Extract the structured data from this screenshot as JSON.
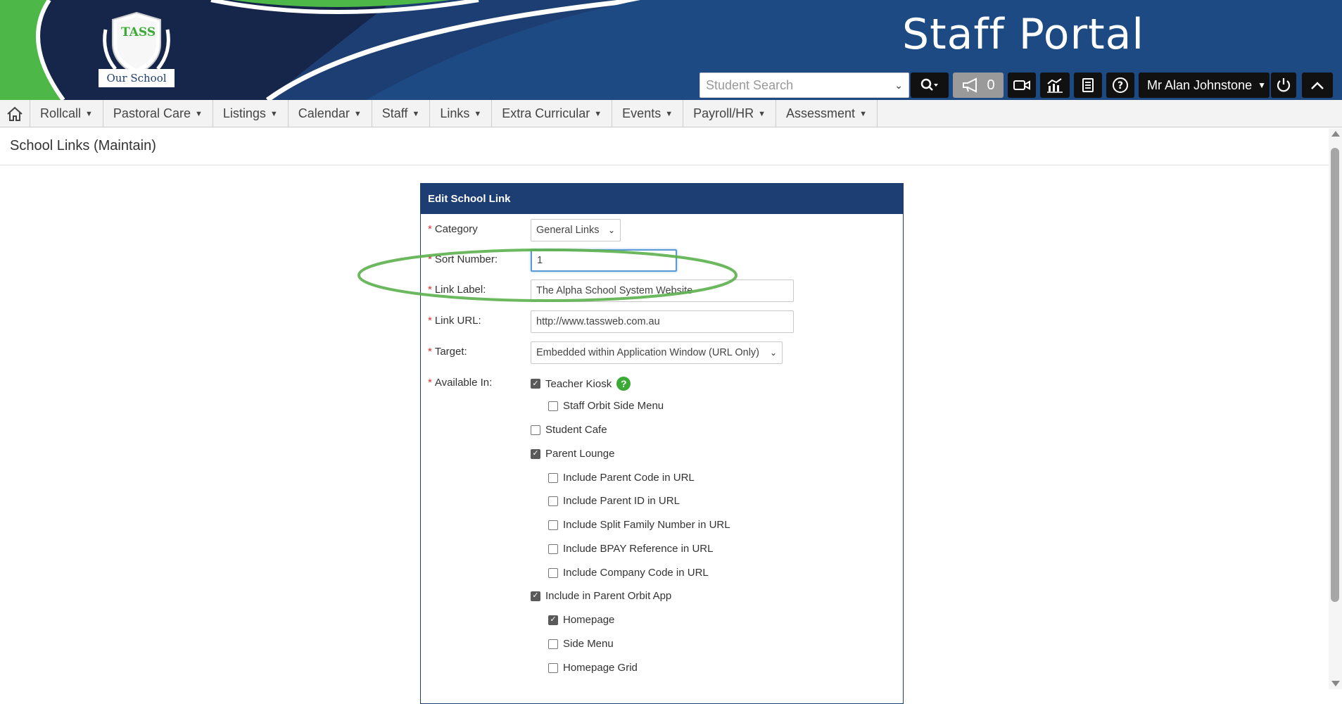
{
  "header": {
    "logo_text": "TASS",
    "logo_caption": "Our School",
    "portal_title": "Staff Portal",
    "search_placeholder": "Student Search",
    "notification_count": "0",
    "user_name": "Mr Alan Johnstone",
    "colors": {
      "banner": "#1d3e72",
      "accent_green": "#4db848"
    }
  },
  "nav": {
    "items": [
      "Rollcall",
      "Pastoral Care",
      "Listings",
      "Calendar",
      "Staff",
      "Links",
      "Extra Curricular",
      "Events",
      "Payroll/HR",
      "Assessment"
    ]
  },
  "page": {
    "title": "School Links (Maintain)"
  },
  "form": {
    "heading": "Edit School Link",
    "required_mark": "*",
    "category": {
      "label": "Category",
      "value": "General Links"
    },
    "sort_number": {
      "label": "Sort Number:",
      "value": "1"
    },
    "link_label": {
      "label": "Link Label:",
      "value": "The Alpha School System Website"
    },
    "link_url": {
      "label": "Link URL:",
      "value": "http://www.tassweb.com.au"
    },
    "target": {
      "label": "Target:",
      "value": "Embedded within Application Window (URL Only)"
    },
    "available_in": {
      "label": "Available In:",
      "options": [
        {
          "label": "Teacher Kiosk",
          "checked": true
        },
        {
          "label": "Staff Orbit Side Menu",
          "checked": false
        },
        {
          "label": "Student Cafe",
          "checked": false
        },
        {
          "label": "Parent Lounge",
          "checked": true
        },
        {
          "label": "Include Parent Code in URL",
          "checked": false
        },
        {
          "label": "Include Parent ID in URL",
          "checked": false
        },
        {
          "label": "Include Split Family Number in URL",
          "checked": false
        },
        {
          "label": "Include BPAY Reference in URL",
          "checked": false
        },
        {
          "label": "Include Company Code in URL",
          "checked": false
        },
        {
          "label": "Include in Parent Orbit App",
          "checked": true
        },
        {
          "label": "Homepage",
          "checked": true
        },
        {
          "label": "Side Menu",
          "checked": false
        },
        {
          "label": "Homepage Grid",
          "checked": false
        }
      ]
    }
  }
}
